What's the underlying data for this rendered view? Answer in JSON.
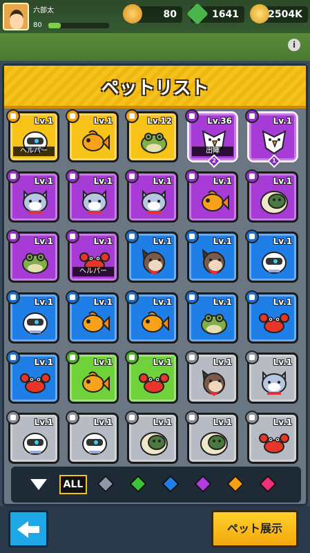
{
  "player": {
    "name": "六部太",
    "level": "80"
  },
  "currencies": [
    {
      "icon": "coin-icon",
      "value": "80"
    },
    {
      "icon": "gem-plus-icon",
      "value": "1641"
    },
    {
      "icon": "gold-coin-icon",
      "value": "2504K"
    }
  ],
  "panel": {
    "title": "ペットリスト"
  },
  "pets": [
    {
      "pet": "robot",
      "rarity": "gold",
      "level": "Lv.1",
      "tag": "ヘルパー"
    },
    {
      "pet": "fish",
      "rarity": "gold",
      "level": "Lv.1"
    },
    {
      "pet": "frog",
      "rarity": "gold",
      "level": "Lv.12"
    },
    {
      "pet": "bird",
      "rarity": "purple",
      "level": "Lv.36",
      "tag": "出陣",
      "slot": "2",
      "selected": true
    },
    {
      "pet": "bird",
      "rarity": "purple",
      "level": "Lv.1",
      "slot": "1",
      "selected": true
    },
    {
      "pet": "cat",
      "rarity": "purple",
      "level": "Lv.1"
    },
    {
      "pet": "cat",
      "rarity": "purple",
      "level": "Lv.1"
    },
    {
      "pet": "cat",
      "rarity": "purple",
      "level": "Lv.1"
    },
    {
      "pet": "fish",
      "rarity": "purple",
      "level": "Lv.1"
    },
    {
      "pet": "turtle",
      "rarity": "purple",
      "level": "Lv.1"
    },
    {
      "pet": "frog",
      "rarity": "purple",
      "level": "Lv.1"
    },
    {
      "pet": "crab",
      "rarity": "purple",
      "level": "Lv.1",
      "tag": "ヘルパー"
    },
    {
      "pet": "dog",
      "rarity": "blue",
      "level": "Lv.1"
    },
    {
      "pet": "dog",
      "rarity": "blue",
      "level": "Lv.1"
    },
    {
      "pet": "robot",
      "rarity": "blue",
      "level": "Lv.1"
    },
    {
      "pet": "robot",
      "rarity": "blue",
      "level": "Lv.1"
    },
    {
      "pet": "fish",
      "rarity": "blue",
      "level": "Lv.1"
    },
    {
      "pet": "fish",
      "rarity": "blue",
      "level": "Lv.1"
    },
    {
      "pet": "frog",
      "rarity": "blue",
      "level": "Lv.1"
    },
    {
      "pet": "crab",
      "rarity": "blue",
      "level": "Lv.1"
    },
    {
      "pet": "crab",
      "rarity": "blue",
      "level": "Lv.1"
    },
    {
      "pet": "fish",
      "rarity": "green",
      "level": "Lv.1"
    },
    {
      "pet": "crab",
      "rarity": "green",
      "level": "Lv.1"
    },
    {
      "pet": "dog",
      "rarity": "gray",
      "level": "Lv.1"
    },
    {
      "pet": "cat",
      "rarity": "gray",
      "level": "Lv.1"
    },
    {
      "pet": "robot",
      "rarity": "gray",
      "level": "Lv.1"
    },
    {
      "pet": "robot",
      "rarity": "gray",
      "level": "Lv.1"
    },
    {
      "pet": "turtle",
      "rarity": "gray",
      "level": "Lv.1"
    },
    {
      "pet": "turtle",
      "rarity": "gray",
      "level": "Lv.1"
    },
    {
      "pet": "crab",
      "rarity": "gray",
      "level": "Lv.1"
    }
  ],
  "filter": {
    "all_label": "ALL",
    "gems": [
      {
        "name": "gray",
        "color": "#8e98a8"
      },
      {
        "name": "green",
        "color": "#3fc23a"
      },
      {
        "name": "blue",
        "color": "#1f7fe6"
      },
      {
        "name": "purple",
        "color": "#b33be0"
      },
      {
        "name": "orange",
        "color": "#f5a012"
      },
      {
        "name": "pink",
        "color": "#f0307a"
      }
    ]
  },
  "buttons": {
    "pet_display": "ペット展示"
  },
  "icons": {
    "back": "back-arrow-icon",
    "info": "info-icon",
    "filter": "sort-down-icon"
  }
}
